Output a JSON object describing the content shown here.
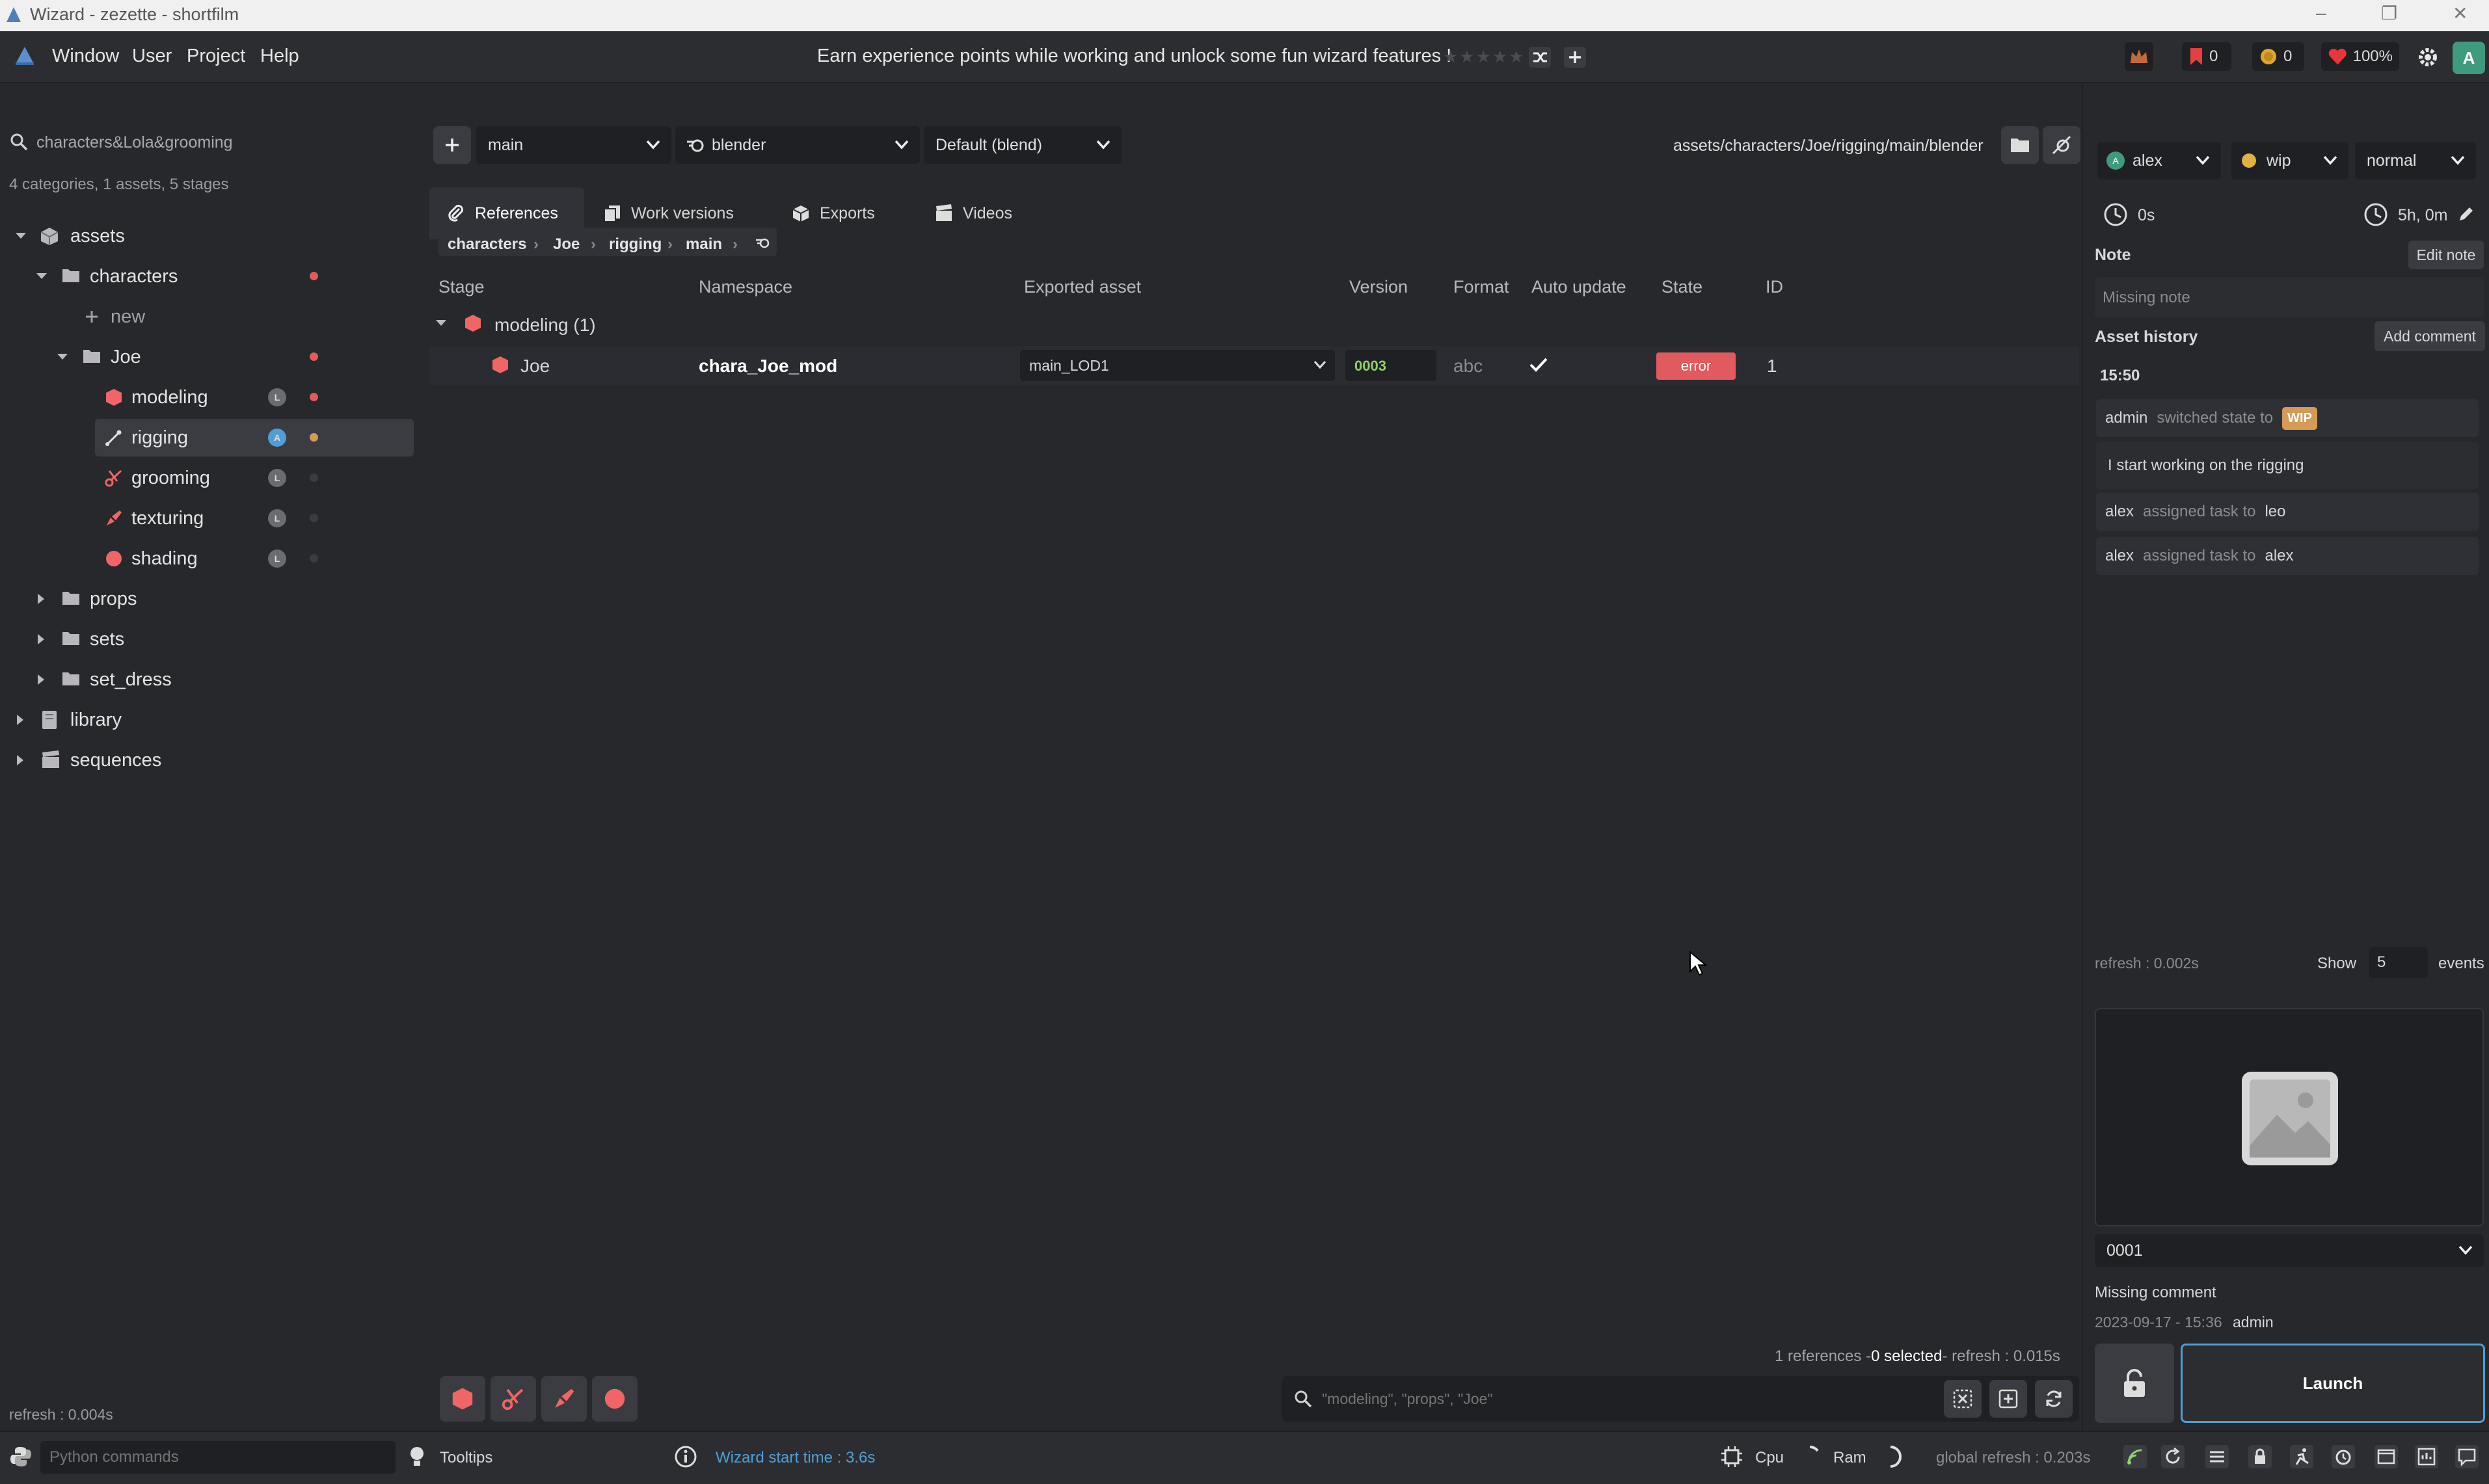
{
  "window": {
    "title": "Wizard - zezette - shortfilm",
    "minimize": "–",
    "maximize": "❐",
    "close": "✕"
  },
  "menu": {
    "items": [
      "Window",
      "User",
      "Project",
      "Help"
    ],
    "banner": "Earn experience points while working and unlock some fun wizard features !",
    "stars_text": "★★★★★",
    "flags_count": "0",
    "coins_count": "0",
    "life_percent": "100%",
    "user_initial": "A"
  },
  "left": {
    "search_value": "characters&Lola&grooming",
    "search_summary": "4 categories, 1 assets, 5 stages",
    "tree": {
      "assets": "assets",
      "characters": "characters",
      "new": "new",
      "joe": "Joe",
      "modeling": "modeling",
      "rigging": "rigging",
      "grooming": "grooming",
      "texturing": "texturing",
      "shading": "shading",
      "props": "props",
      "sets": "sets",
      "set_dress": "set_dress",
      "library": "library",
      "sequences": "sequences"
    },
    "stage_avatar_letter": "L",
    "rigging_avatar_letter": "A",
    "refresh": "refresh : 0.004s"
  },
  "center": {
    "variant": "main",
    "software": "blender",
    "extension": "Default (blend)",
    "path": "assets/characters/Joe/rigging/main/blender",
    "tabs": [
      "References",
      "Work versions",
      "Exports",
      "Videos"
    ],
    "breadcrumb": [
      "characters",
      "Joe",
      "rigging",
      "main"
    ],
    "columns": [
      "Stage",
      "Namespace",
      "Exported asset",
      "Version",
      "Format",
      "Auto update",
      "State",
      "ID"
    ],
    "group_label": "modeling (1)",
    "row": {
      "stage": "Joe",
      "namespace": "chara_Joe_mod",
      "exported_asset": "main_LOD1",
      "version": "0003",
      "format": "abc",
      "state": "error",
      "id": "1"
    },
    "footer": {
      "references": "1 references - ",
      "selected": "0 selected",
      "refresh": " - refresh : 0.015s"
    },
    "search_placeholder": "\"modeling\", \"props\", \"Joe\""
  },
  "right": {
    "user": "alex",
    "state": "wip",
    "priority": "normal",
    "work_time": "0s",
    "estimated_time": "5h, 0m",
    "note_label": "Note",
    "edit_note": "Edit note",
    "note_value": "Missing note",
    "history_label": "Asset history",
    "add_comment": "Add comment",
    "time": "15:50",
    "history": {
      "e1_user": "admin",
      "e1_text": "switched state to",
      "e1_badge": "WIP",
      "comment": "I start working on the rigging",
      "e2_user": "alex",
      "e2_text": "assigned task to",
      "e2_target": "leo",
      "e3_user": "alex",
      "e3_text": "assigned task to",
      "e3_target": "alex"
    },
    "refresh": "refresh : 0.002s",
    "show_label": "Show",
    "show_value": "5",
    "events_label": "events",
    "version_select": "0001",
    "version_comment": "Missing comment",
    "version_date": "2023-09-17 - 15:36",
    "version_user": "admin",
    "launch": "Launch"
  },
  "status": {
    "python_placeholder": "Python commands",
    "tooltips": "Tooltips",
    "start_time": "Wizard start time : 3.6s",
    "cpu": "Cpu",
    "ram": "Ram",
    "global_refresh": "global refresh : 0.203s"
  },
  "colors": {
    "accent": "#4f9fd6",
    "error": "#e05a5e",
    "wip": "#d59b56",
    "version_green": "#8fd36c",
    "stage_red": "#f06565"
  }
}
